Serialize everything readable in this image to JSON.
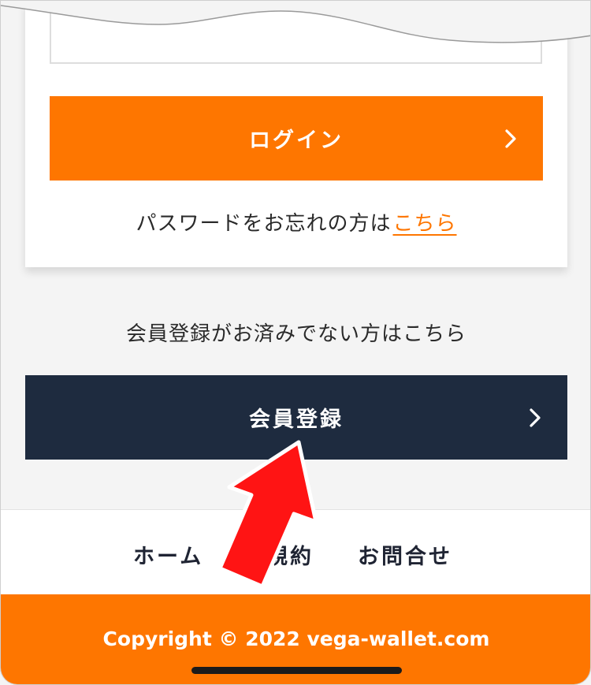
{
  "login": {
    "button_label": "ログイン",
    "forgot_text": "パスワードをお忘れの方は",
    "forgot_link": "こちら"
  },
  "register": {
    "prompt": "会員登録がお済みでない方はこちら",
    "button_label": "会員登録"
  },
  "footer_nav": {
    "home": "ホーム",
    "terms": "規約",
    "contact": "お問合せ"
  },
  "footer": {
    "copyright": "Copyright © 2022 vega-wallet.com"
  },
  "colors": {
    "accent": "#fe7600",
    "navy": "#1e2b3f",
    "annotation_arrow": "#ff0000"
  },
  "icons": {
    "chevron": "chevron-right-icon",
    "annotation": "red-arrow-icon"
  }
}
